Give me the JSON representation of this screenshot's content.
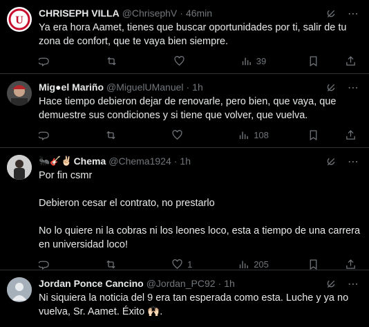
{
  "tweets": [
    {
      "name": "CHRISEPH VILLA",
      "handle": "@ChrisephV",
      "dot": "·",
      "time": "46min",
      "text": "Ya era hora Aamet, tienes que buscar oportunidades por ti, salir de tu zona de confort, que te vaya bien siempre.",
      "views": "39",
      "likes": ""
    },
    {
      "name": "Mig●el Mariño",
      "handle": "@MiguelUManuel",
      "dot": "·",
      "time": "1h",
      "text": "Hace tiempo debieron dejar de renovarle, pero bien, que vaya, que demuestre sus condiciones y si tiene que volver, que vuelva.",
      "views": "108",
      "likes": ""
    },
    {
      "name_prefix": "🐜🎸✌🏻",
      "name": "Chema",
      "handle": "@Chema1924",
      "dot": "·",
      "time": "1h",
      "text": "Por fin csmr\n\nDebieron cesar el contrato, no prestarlo\n\nNo lo quiere ni la cobras ni los leones loco, esta a tiempo de una carrera en universidad loco!",
      "views": "205",
      "likes": "1"
    },
    {
      "name": "Jordan Ponce Cancino",
      "handle": "@Jordan_PC92",
      "dot": "·",
      "time": "1h",
      "text": "Ni siquiera la noticia del 9 era tan esperada como esta. Luche y ya no vuelva, Sr. Aamet. Éxito 🙌🏻."
    }
  ],
  "colors": {
    "background": "#000000",
    "text": "#e7e9ea",
    "muted": "#71767b",
    "divider": "#2f3336"
  },
  "icons": [
    "grok-icon",
    "more-icon",
    "reply-icon",
    "retweet-icon",
    "like-icon",
    "views-icon",
    "bookmark-icon",
    "share-icon"
  ]
}
